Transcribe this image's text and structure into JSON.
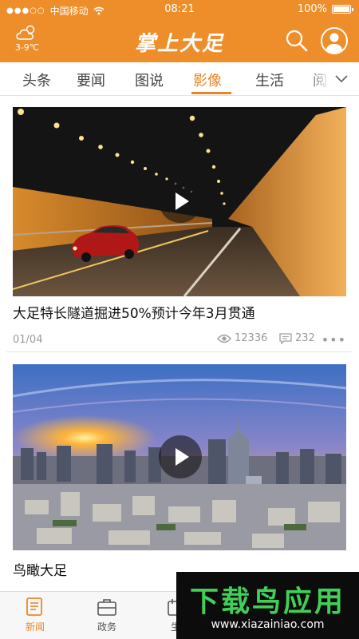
{
  "status_bar": {
    "signal_dots": "●●●○○",
    "carrier": "中国移动",
    "time": "08:21",
    "battery": "100%"
  },
  "header": {
    "temperature": "3-9℃",
    "logo_text": "掌上大足",
    "icons": [
      "weather-cloud-icon",
      "search-icon",
      "user-icon"
    ]
  },
  "tabs": [
    {
      "label": "头条",
      "active": false
    },
    {
      "label": "要闻",
      "active": false
    },
    {
      "label": "图说",
      "active": false
    },
    {
      "label": "影像",
      "active": true
    },
    {
      "label": "生活",
      "active": false
    },
    {
      "label": "阅",
      "active": false
    }
  ],
  "feed": [
    {
      "title": "大足特长隧道掘进50%预计今年3月贯通",
      "date": "01/04",
      "views": "12336",
      "comments": "232",
      "more": "•••"
    },
    {
      "title": "鸟瞰大足"
    }
  ],
  "bottom_nav": [
    {
      "label": "新闻",
      "icon": "news-icon",
      "active": true
    },
    {
      "label": "政务",
      "icon": "briefcase-icon",
      "active": false
    },
    {
      "label": "生",
      "icon": "life-icon",
      "active": false
    }
  ],
  "watermark": {
    "title": "下载鸟应用",
    "url": "www.xiazainiao.com"
  },
  "colors": {
    "brand_orange": "#ee8e2a",
    "active_tab": "#e8862a",
    "watermark_green": "#42cf58"
  }
}
